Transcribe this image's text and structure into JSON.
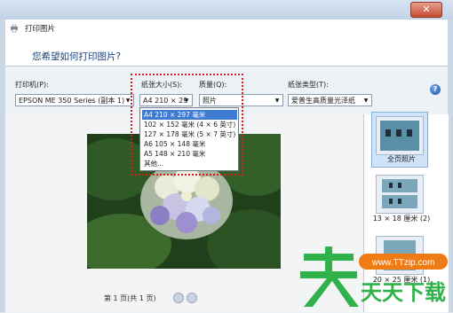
{
  "window": {
    "title": "打印图片",
    "close_glyph": "✕"
  },
  "header": {
    "question": "您希望如何打印图片?"
  },
  "printer": {
    "label": "打印机(P):",
    "value": "EPSON ME 350 Series (副本 1)"
  },
  "paper_size": {
    "label": "纸张大小(S):",
    "value": "A4 210 × 29",
    "options": [
      "A4 210 × 297 毫米",
      "102 × 152 毫米 (4 × 6 英寸)",
      "127 × 178 毫米 (5 × 7 英寸)",
      "A6 105 × 148 毫米",
      "A5 148 × 210 毫米",
      "其他..."
    ],
    "selected_index": 0
  },
  "quality": {
    "label": "质量(Q):",
    "value": "照片"
  },
  "paper_type": {
    "label": "纸张类型(T):",
    "value": "爱普生高质量光泽纸"
  },
  "preview": {
    "pager": "第 1 页(共 1 页)"
  },
  "layouts": [
    {
      "label": "全页照片"
    },
    {
      "label": "13 × 18 厘米 (2)"
    },
    {
      "label": "20 × 25 厘米 (1)"
    }
  ],
  "watermark": {
    "site": "www.TTzip.com",
    "brand": "天天下载",
    "big_char": "天"
  },
  "colors": {
    "accent": "#3d7cd0",
    "highlight_box": "#d11e1e",
    "title_text": "#1a3e78"
  }
}
